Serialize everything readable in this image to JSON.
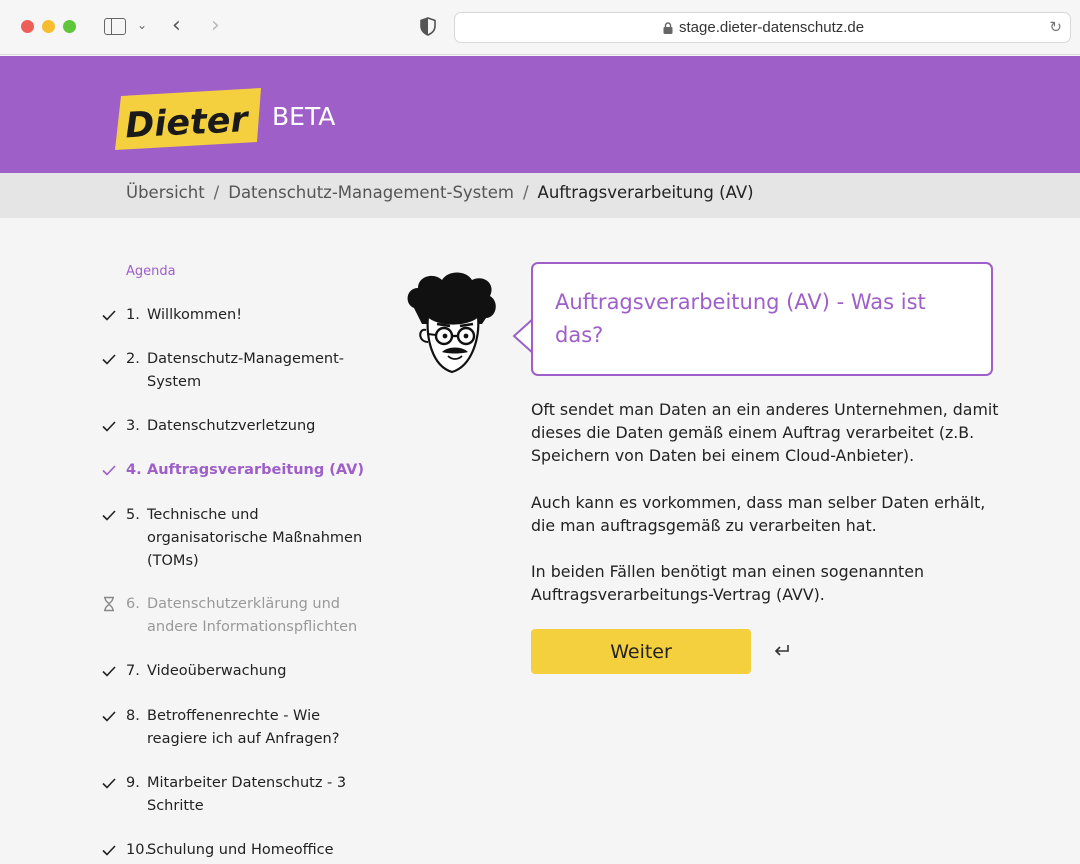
{
  "browser": {
    "url": "stage.dieter-datenschutz.de"
  },
  "header": {
    "logo_text": "Dieter",
    "badge": "BETA"
  },
  "breadcrumb": {
    "items": [
      "Übersicht",
      "Datenschutz-Management-System",
      "Auftragsverarbeitung (AV)"
    ],
    "separator": "/"
  },
  "agenda": {
    "title": "Agenda",
    "items": [
      {
        "num": "1.",
        "label": "Willkommen!",
        "status": "done"
      },
      {
        "num": "2.",
        "label": "Datenschutz-Management-System",
        "status": "done"
      },
      {
        "num": "3.",
        "label": "Datenschutzverletzung",
        "status": "done"
      },
      {
        "num": "4.",
        "label": "Auftragsverarbeitung (AV)",
        "status": "active"
      },
      {
        "num": "5.",
        "label": "Technische und organisatorische Maßnahmen (TOMs)",
        "status": "done"
      },
      {
        "num": "6.",
        "label": "Datenschutzerklärung und andere Informationspflichten",
        "status": "pending"
      },
      {
        "num": "7.",
        "label": "Videoüberwachung",
        "status": "done"
      },
      {
        "num": "8.",
        "label": "Betroffenenrechte - Wie reagiere ich auf Anfragen?",
        "status": "done"
      },
      {
        "num": "9.",
        "label": "Mitarbeiter Datenschutz - 3 Schritte",
        "status": "done"
      },
      {
        "num": "10.",
        "label": "Schulung und Homeoffice",
        "status": "done"
      }
    ]
  },
  "content": {
    "title": "Auftragsverarbeitung (AV) - Was ist das?",
    "paragraphs": [
      "Oft sendet man Daten an ein anderes Unternehmen, damit dieses die Daten gemäß einem Auftrag verarbeitet (z.B. Speichern von Daten bei einem Cloud-Anbieter).",
      "Auch kann es vorkommen, dass man selber Daten erhält, die man auftragsgemäß zu verarbeiten hat.",
      "In beiden Fällen benötigt man einen sogenannten Auftragsverarbeitungs-Vertrag (AVV)."
    ],
    "button_label": "Weiter"
  },
  "colors": {
    "accent": "#9e5fc9",
    "button": "#f4d03f"
  }
}
